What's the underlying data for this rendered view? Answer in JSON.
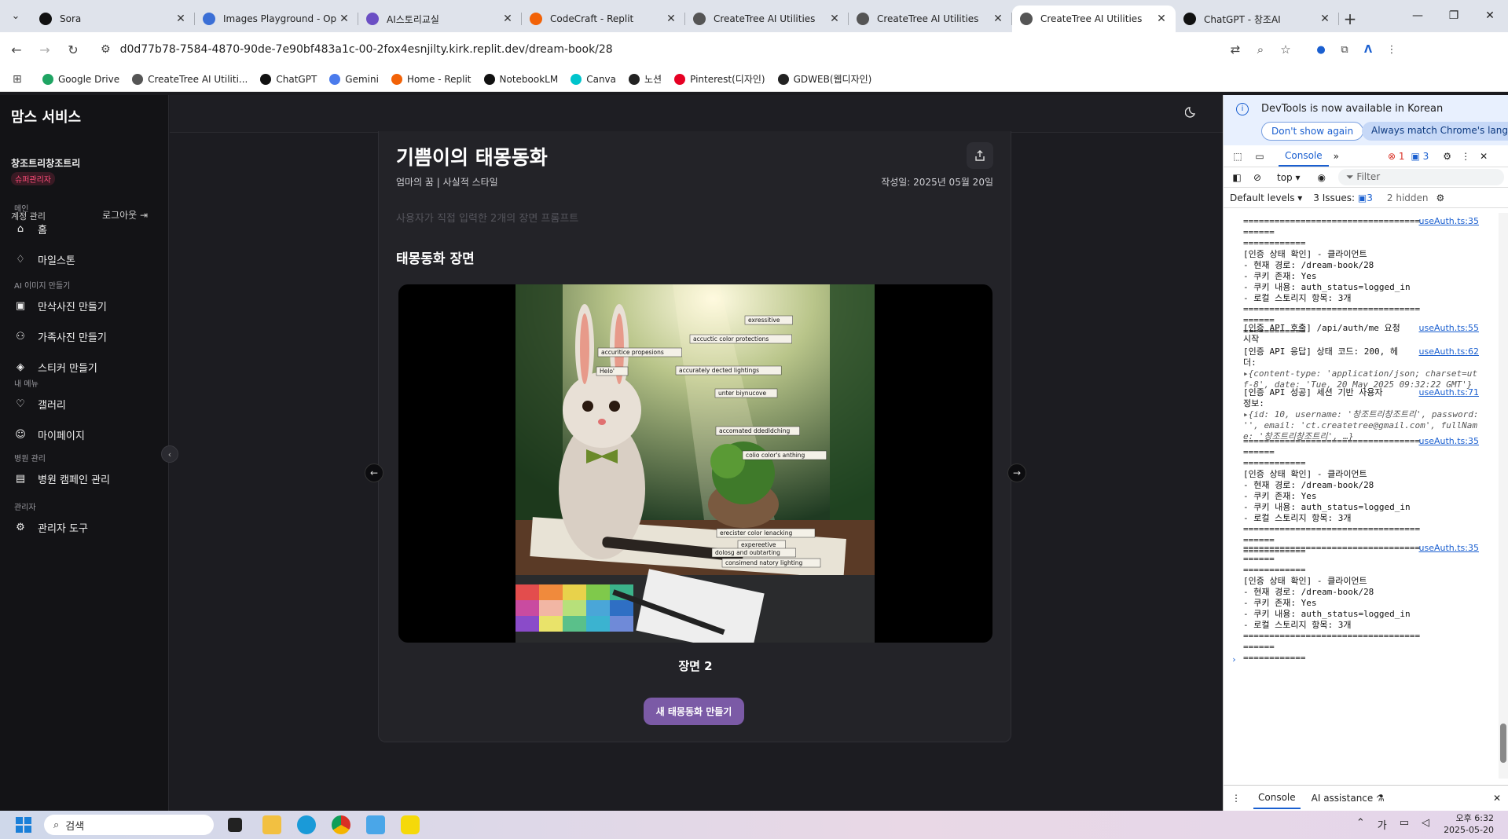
{
  "browser": {
    "tabs": [
      {
        "title": "Sora",
        "fav_color": "#111111",
        "active": false
      },
      {
        "title": "Images Playground - Op",
        "fav_color": "#3b6fd6",
        "active": false
      },
      {
        "title": "AI스토리교실",
        "fav_color": "#6b4fc4",
        "active": false
      },
      {
        "title": "CodeCraft - Replit",
        "fav_color": "#f26207",
        "active": false
      },
      {
        "title": "CreateTree AI Utilities",
        "fav_color": "#555555",
        "active": false
      },
      {
        "title": "CreateTree AI Utilities",
        "fav_color": "#555555",
        "active": false
      },
      {
        "title": "CreateTree AI Utilities",
        "fav_color": "#555555",
        "active": true
      },
      {
        "title": "ChatGPT - 창조AI",
        "fav_color": "#111111",
        "active": false
      }
    ],
    "url": "d0d77b78-7584-4870-90de-7e90bf483a1c-00-2fox4esnjilty.kirk.replit.dev/dream-book/28",
    "bookmarks": [
      {
        "label": "Google Drive",
        "color": "#1fa463"
      },
      {
        "label": "CreateTree AI Utiliti...",
        "color": "#555555"
      },
      {
        "label": "ChatGPT",
        "color": "#111111"
      },
      {
        "label": "Gemini",
        "color": "#4b7bec"
      },
      {
        "label": "Home - Replit",
        "color": "#f26207"
      },
      {
        "label": "NotebookLM",
        "color": "#111111"
      },
      {
        "label": "Canva",
        "color": "#00c4cc"
      },
      {
        "label": "노션",
        "color": "#222222"
      },
      {
        "label": "Pinterest(디자인)",
        "color": "#e60023"
      },
      {
        "label": "GDWEB(웹디자인)",
        "color": "#222222"
      }
    ]
  },
  "sidebar": {
    "brand": "맘스 서비스",
    "user_name": "창조트리창조트리",
    "role": "슈퍼관리자",
    "account_label": "계정 관리",
    "logout_label": "로그아웃",
    "sections": [
      {
        "label": "메인",
        "items": [
          {
            "label": "홈",
            "icon": "home-icon"
          },
          {
            "label": "마일스톤",
            "icon": "award-icon"
          }
        ]
      },
      {
        "label": "AI 이미지 만들기",
        "items": [
          {
            "label": "만삭사진 만들기",
            "icon": "image-plus-icon"
          },
          {
            "label": "가족사진 만들기",
            "icon": "users-icon"
          },
          {
            "label": "스티커 만들기",
            "icon": "sticker-icon"
          }
        ]
      },
      {
        "label": "내 메뉴",
        "items": [
          {
            "label": "갤러리",
            "icon": "heart-icon"
          },
          {
            "label": "마이페이지",
            "icon": "user-icon"
          }
        ]
      },
      {
        "label": "병원 관리",
        "items": [
          {
            "label": "병원 캠페인 관리",
            "icon": "clipboard-icon"
          }
        ]
      },
      {
        "label": "관리자",
        "items": [
          {
            "label": "관리자 도구",
            "icon": "gear-icon"
          }
        ]
      }
    ]
  },
  "main": {
    "title": "기쁨이의 태몽동화",
    "meta": "엄마의 꿈 | 사실적 스타일",
    "date": "작성일: 2025년 05월 20일",
    "prompt_note": "사용자가 직접 입력한 2개의 장면 프롬프트",
    "scene_heading": "태몽동화 장면",
    "scene_label": "장면 2",
    "new_button": "새 태몽동화 만들기",
    "image_annotations": [
      "exressitive",
      "accuctic color protections",
      "accuritice propesions",
      "Helo'",
      "accurately dected lightings",
      "unter biynucove",
      "accomated ddedldching",
      "colio color's anthing",
      "erecister color lenacking",
      "expereetive",
      "dolosg and oubtarting",
      "consimend natory lighting"
    ]
  },
  "devtools": {
    "info": "DevTools is now available in Korean",
    "dont_show": "Don't show again",
    "always_match": "Always match Chrome's languag",
    "tab_console": "Console",
    "errors": "1",
    "messages": "3",
    "context": "top",
    "filter_placeholder": "Filter",
    "levels": "Default levels",
    "issues": "3 Issues:",
    "issues_count": "3",
    "hidden": "2 hidden",
    "logs": [
      {
        "src": "useAuth.ts:35",
        "text": "========================================\n============\n[인증 상태 확인] - 클라이언트\n- 현재 경로: /dream-book/28\n- 쿠키 존재: Yes\n- 쿠키 내용: auth_status=logged_in\n- 로컬 스토리지 항목: 3개\n========================================\n============"
      },
      {
        "src": "useAuth.ts:55",
        "text": "[인증 API 호출] /api/auth/me 요청\n시작"
      },
      {
        "src": "useAuth.ts:62",
        "text": "[인증 API 응답] 상태 코드: 200, 헤\n더:",
        "obj": "▸{content-type: 'application/json; charset=utf-8', date: 'Tue, 20 May 2025 09:32:22 GMT'}"
      },
      {
        "src": "useAuth.ts:71",
        "text": "[인증 API 성공] 세션 기반 사용자\n정보:",
        "obj": "▸{id: 10, username: '창조트리창조트리', password: '', email: 'ct.createtree@gmail.com', fullName: '창조트리창조트리', …}"
      },
      {
        "src": "useAuth.ts:35",
        "text": "========================================\n============\n[인증 상태 확인] - 클라이언트\n- 현재 경로: /dream-book/28\n- 쿠키 존재: Yes\n- 쿠키 내용: auth_status=logged_in\n- 로컬 스토리지 항목: 3개\n========================================\n============"
      },
      {
        "src": "useAuth.ts:35",
        "text": "========================================\n============\n[인증 상태 확인] - 클라이언트\n- 현재 경로: /dream-book/28\n- 쿠키 존재: Yes\n- 쿠키 내용: auth_status=logged_in\n- 로컬 스토리지 항목: 3개\n========================================\n============"
      }
    ],
    "drawer_console": "Console",
    "drawer_ai": "AI assistance"
  },
  "taskbar": {
    "search_placeholder": "검색",
    "ime": "가",
    "ampm_time": "오후 6:32",
    "date": "2025-05-20"
  }
}
